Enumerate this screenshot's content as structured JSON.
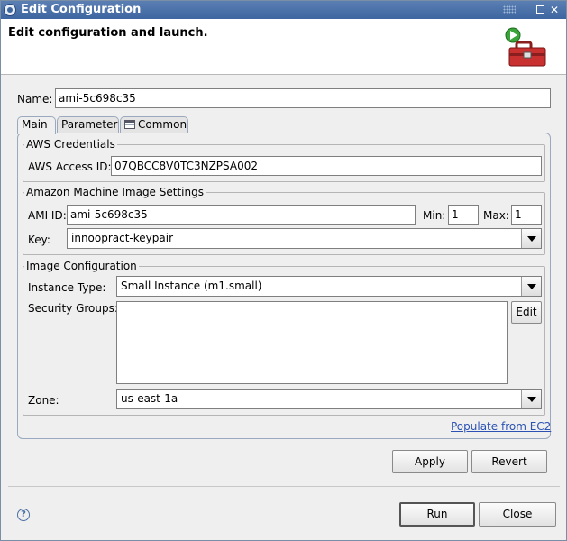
{
  "window": {
    "title": "Edit Configuration",
    "restore_glyph": "",
    "close_glyph": "✕"
  },
  "header": {
    "heading": "Edit configuration and launch."
  },
  "name_field": {
    "label": "Name:",
    "value": "ami-5c698c35"
  },
  "tabs": [
    {
      "label": "Main"
    },
    {
      "label": "Parameter"
    },
    {
      "label": "Common"
    }
  ],
  "aws_credentials": {
    "title": "AWS Credentials",
    "access_id_label": "AWS Access ID:",
    "access_id_value": "07QBCC8V0TC3NZPSA002"
  },
  "ami_settings": {
    "title": "Amazon Machine Image Settings",
    "ami_id_label": "AMI ID:",
    "ami_id_value": "ami-5c698c35",
    "min_label": "Min:",
    "min_value": "1",
    "max_label": "Max:",
    "max_value": "1",
    "key_label": "Key:",
    "key_value": "innoopract-keypair"
  },
  "image_config": {
    "title": "Image Configuration",
    "instance_type_label": "Instance Type:",
    "instance_type_value": "Small Instance (m1.small)",
    "security_groups_label": "Security Groups:",
    "edit_label": "Edit",
    "zone_label": "Zone:",
    "zone_value": "us-east-1a"
  },
  "populate_link": "Populate from EC2",
  "buttons": {
    "apply": "Apply",
    "revert": "Revert",
    "run": "Run",
    "close": "Close"
  },
  "help_glyph": "?"
}
